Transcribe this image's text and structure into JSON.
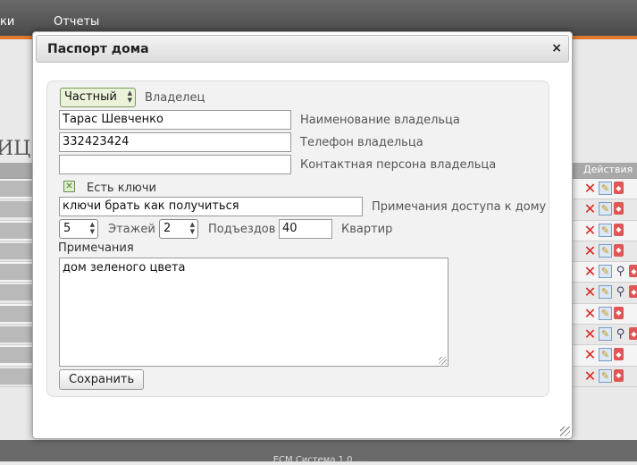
{
  "app": {
    "nav": [
      "ки",
      "Отчеты"
    ],
    "page_title_fragment": "ИЦ",
    "table_header_actions": "Действия",
    "rows": [
      {
        "search": false
      },
      {
        "search": false
      },
      {
        "search": false
      },
      {
        "search": false
      },
      {
        "search": true
      },
      {
        "search": true
      },
      {
        "search": false
      },
      {
        "search": true
      },
      {
        "search": false
      },
      {
        "search": false
      }
    ],
    "footer": "ЕСМ Система 1.0 ..."
  },
  "dialog": {
    "title": "Паспорт дома",
    "close": "×",
    "owner_type": {
      "value": "Частный",
      "label": "Владелец"
    },
    "owner_name": {
      "value": "Тарас Шевченко",
      "label": "Наименование владельца"
    },
    "owner_phone": {
      "value": "332423424",
      "label": "Телефон владельца"
    },
    "owner_contact": {
      "value": "",
      "label": "Контактная персона владельца"
    },
    "has_keys": {
      "checked": true,
      "label": "Есть ключи"
    },
    "access_notes": {
      "value": "ключи брать как получиться",
      "label": "Примечания доступа к дому"
    },
    "floors": {
      "value": "5",
      "label": "Этажей"
    },
    "entrances": {
      "value": "2",
      "label": "Подъездов"
    },
    "apartments": {
      "value": "40",
      "label": "Квартир"
    },
    "notes": {
      "label": "Примечания",
      "value": "дом зеленого цвета"
    },
    "save_label": "Сохранить"
  },
  "colors": {
    "accent": "#e07a2e",
    "header_bg": "#5a5a5a",
    "checkbox_green": "#4b7a2c"
  }
}
